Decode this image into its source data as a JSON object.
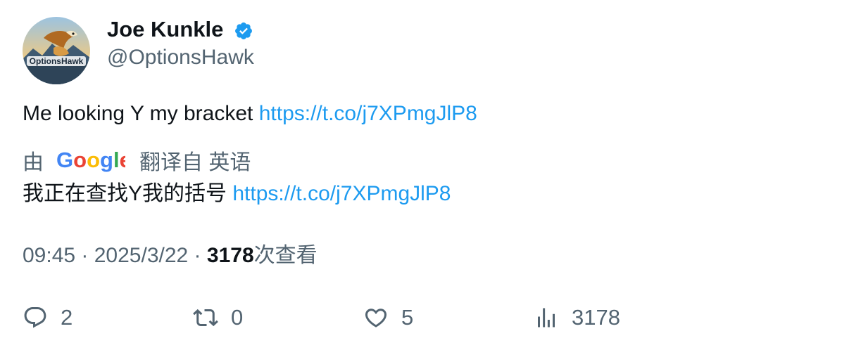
{
  "author": {
    "display_name": "Joe Kunkle",
    "handle": "@OptionsHawk",
    "verified": true,
    "avatar_text": "OptionsHawk"
  },
  "tweet": {
    "text": "Me looking Y my bracket ",
    "link": "https://t.co/j7XPmgJlP8"
  },
  "translation": {
    "by_label": "由",
    "provider": "Google",
    "translated_from": "翻译自 英语",
    "text": "我正在查找Y我的括号 ",
    "link": "https://t.co/j7XPmgJlP8"
  },
  "meta": {
    "time": "09:45",
    "separator1": " · ",
    "date": "2025/3/22",
    "separator2": " · ",
    "views_count": "3178",
    "views_label": "次查看"
  },
  "actions": {
    "replies": "2",
    "retweets": "0",
    "likes": "5",
    "views": "3178"
  },
  "colors": {
    "link": "#1d9bf0",
    "secondary_text": "#536471",
    "primary_text": "#0f1419",
    "verified": "#1d9bf0"
  }
}
